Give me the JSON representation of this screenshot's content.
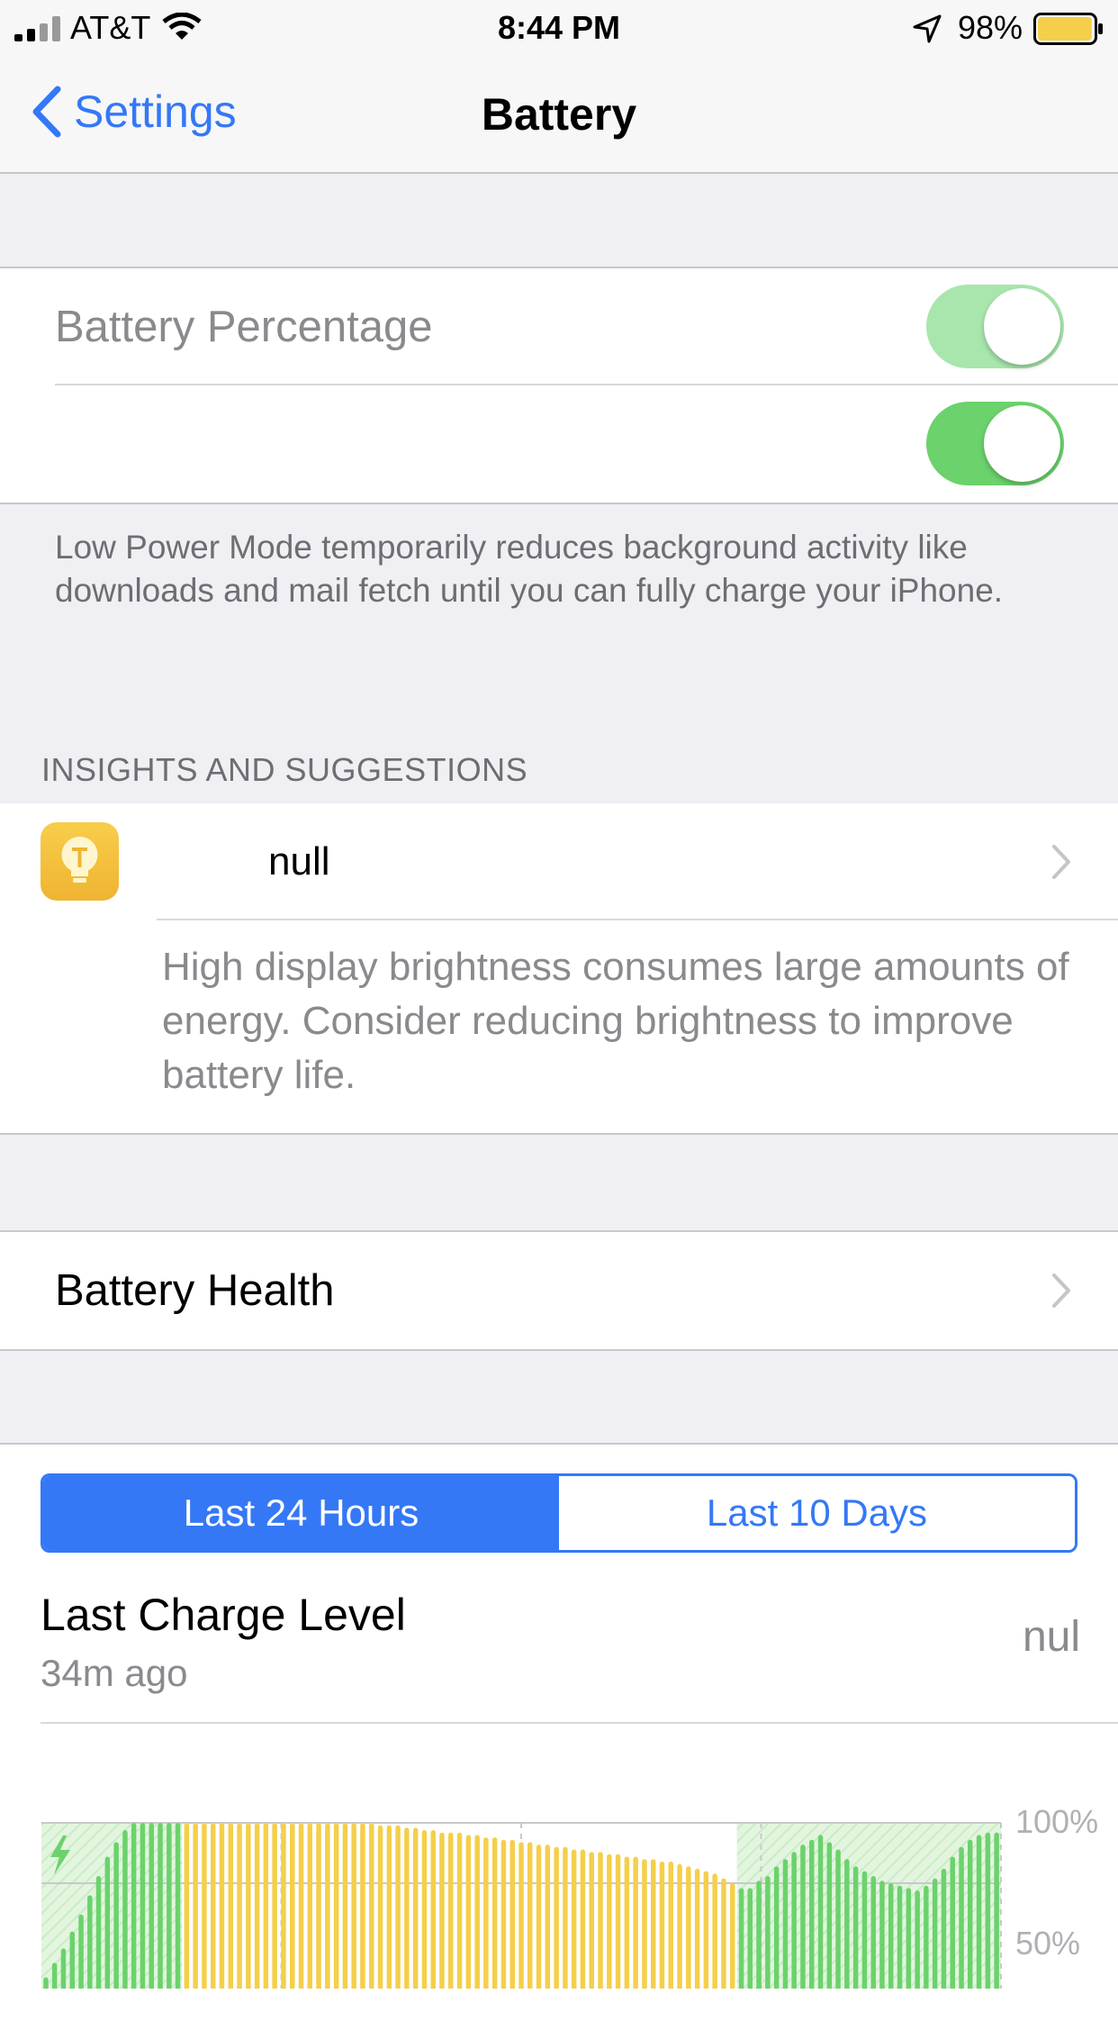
{
  "status_bar": {
    "carrier": "AT&T",
    "time": "8:44 PM",
    "battery_percent": "98%",
    "battery_level": 0.98
  },
  "nav": {
    "back_label": "Settings",
    "title": "Battery"
  },
  "settings": {
    "battery_percentage": {
      "label": "Battery Percentage",
      "on": true
    },
    "low_power_mode": {
      "label": "",
      "on": true
    }
  },
  "low_power_footer": "Low Power Mode temporarily reduces background activity like downloads and mail fetch until you can fully charge your iPhone.",
  "insights": {
    "header": "INSIGHTS AND SUGGESTIONS",
    "title": "null",
    "description": "High display brightness consumes large amounts of energy. Consider reducing brightness to improve battery life."
  },
  "battery_health_label": "Battery Health",
  "segment": {
    "options": [
      "Last 24 Hours",
      "Last 10 Days"
    ],
    "selected": 0
  },
  "last_charge": {
    "title": "Last Charge Level",
    "subtitle": "34m ago",
    "value": "nul"
  },
  "colors": {
    "accent": "#3478f6",
    "toggle_on": "#6bd26c",
    "toggle_on_dim": "#a8e6ad",
    "bar_yellow": "#f5cf4b",
    "bar_green": "#6bd26c",
    "charging_hatch": "#c9ecc6"
  },
  "chart_data": {
    "type": "bar",
    "y_ticks": [
      "100%",
      "50%"
    ],
    "ylim": [
      0,
      100
    ],
    "values": [
      36,
      42,
      48,
      55,
      62,
      70,
      78,
      86,
      92,
      97,
      100,
      100,
      100,
      100,
      100,
      100,
      100,
      100,
      100,
      100,
      100,
      100,
      100,
      100,
      100,
      100,
      100,
      100,
      100,
      100,
      100,
      100,
      100,
      100,
      100,
      100,
      100,
      100,
      99,
      99,
      99,
      98,
      98,
      97,
      97,
      96,
      96,
      96,
      95,
      95,
      94,
      94,
      93,
      93,
      92,
      92,
      91,
      91,
      90,
      90,
      89,
      89,
      88,
      88,
      87,
      87,
      86,
      86,
      85,
      85,
      84,
      84,
      83,
      82,
      81,
      80,
      79,
      77,
      75,
      73,
      73,
      76,
      78,
      82,
      85,
      88,
      91,
      93,
      95,
      92,
      89,
      85,
      82,
      80,
      78,
      76,
      75,
      74,
      73,
      72,
      74,
      77,
      81,
      86,
      90,
      93,
      95,
      96,
      96
    ],
    "charging": [
      1,
      1,
      1,
      1,
      1,
      1,
      1,
      1,
      1,
      1,
      1,
      1,
      1,
      1,
      1,
      1,
      0,
      0,
      0,
      0,
      0,
      0,
      0,
      0,
      0,
      0,
      0,
      0,
      0,
      0,
      0,
      0,
      0,
      0,
      0,
      0,
      0,
      0,
      0,
      0,
      0,
      0,
      0,
      0,
      0,
      0,
      0,
      0,
      0,
      0,
      0,
      0,
      0,
      0,
      0,
      0,
      0,
      0,
      0,
      0,
      0,
      0,
      0,
      0,
      0,
      0,
      0,
      0,
      0,
      0,
      0,
      0,
      0,
      0,
      0,
      0,
      0,
      0,
      0,
      1,
      1,
      1,
      1,
      1,
      1,
      1,
      1,
      1,
      1,
      1,
      1,
      1,
      1,
      1,
      1,
      1,
      1,
      1,
      1,
      1,
      1,
      1,
      1,
      1,
      1,
      1,
      1,
      1,
      1
    ]
  }
}
